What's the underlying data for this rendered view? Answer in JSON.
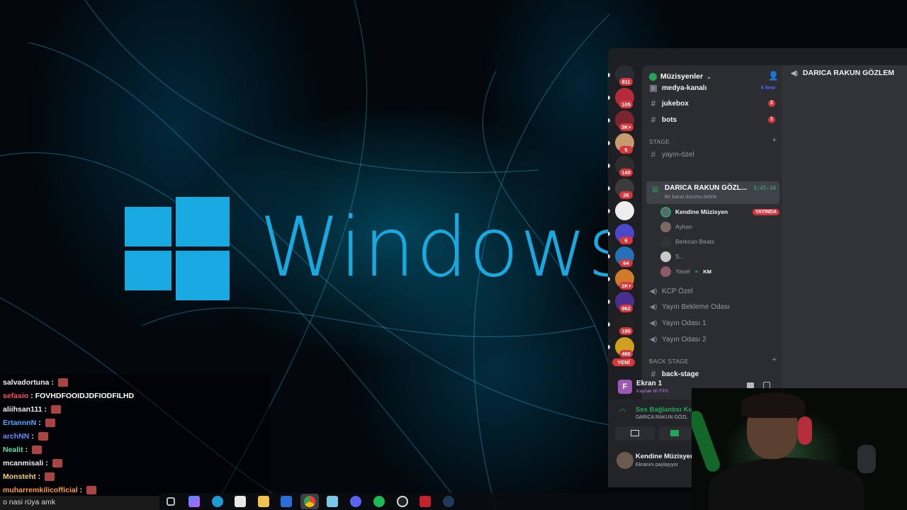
{
  "wallpaper": {
    "brand_word": "Windows"
  },
  "chat": {
    "messages": [
      {
        "user": "salvadortuna",
        "user_color": "#f0f0f0",
        "text": ""
      },
      {
        "user": "sefasio",
        "user_color": "#ff4b6e",
        "text": "FOVHDFOOIDJDFIODFILHD"
      },
      {
        "user": "aliihsan111",
        "user_color": "#f0f0f0",
        "text": ""
      },
      {
        "user": "ErtannnN",
        "user_color": "#4aa8ff",
        "text": ""
      },
      {
        "user": "archNN",
        "user_color": "#6a8cff",
        "text": ""
      },
      {
        "user": "Nealit",
        "user_color": "#62e0a2",
        "text": ""
      },
      {
        "user": "mcanmisali",
        "user_color": "#f0f0f0",
        "text": ""
      },
      {
        "user": "Monsteht",
        "user_color": "#f3d26a",
        "text": ""
      },
      {
        "user": "muharremkilicofficial",
        "user_color": "#ff9a3c",
        "text": ""
      }
    ],
    "input_text": "o nasi rüya amk"
  },
  "discord": {
    "server_name": "Müzisyenler",
    "server_badges": [
      "811",
      "105",
      "3K+",
      "5",
      "140",
      "26",
      "",
      "6",
      "64",
      "1K+",
      "962",
      "195",
      "486"
    ],
    "new_label": "YENİ",
    "channels": [
      {
        "name": "medya-kanalı",
        "note": "6 New"
      },
      {
        "name": "jukebox",
        "count": "2"
      },
      {
        "name": "bots",
        "count": "1"
      }
    ],
    "stage_category": "STAGE",
    "stage_channel": "yayın-özel",
    "active_channel": {
      "name": "DARICA RAKUN GÖZL...",
      "timer": "5:45:34",
      "status": "Bir kanal durumu belirle"
    },
    "members": [
      {
        "name": "Kendine Müzisyen",
        "badge": "YAYINDA",
        "me": true
      },
      {
        "name": "Ayhan"
      },
      {
        "name": "Berkcan Beats"
      },
      {
        "name": "S..."
      },
      {
        "name": "Yasel",
        "tag": "KM"
      }
    ],
    "voice_channels": [
      "KCP Özel",
      "Yayın Bekleme Odası",
      "Yayın Odası 1",
      "Yayın Odası 2"
    ],
    "back_stage_category": "BACK STAGE",
    "back_stage_channel": "back-stage",
    "screen_share": {
      "title": "Ekran 1",
      "subtitle": "Kaynak 60 FPS"
    },
    "voice_status": {
      "title": "Ses Bağlantısı Ku",
      "channel": "DARICA RAKUN GÖZL"
    },
    "user_panel": {
      "name": "Kendine Müzisyen",
      "status": "Ekranını paylaşıyor"
    },
    "right_pane_title": "DARICA RAKUN GÖZLEM"
  },
  "colors": {
    "accent": "#17a9e0",
    "discord_bg": "#2b2d31",
    "live_red": "#da373c",
    "online_green": "#23a55a"
  }
}
